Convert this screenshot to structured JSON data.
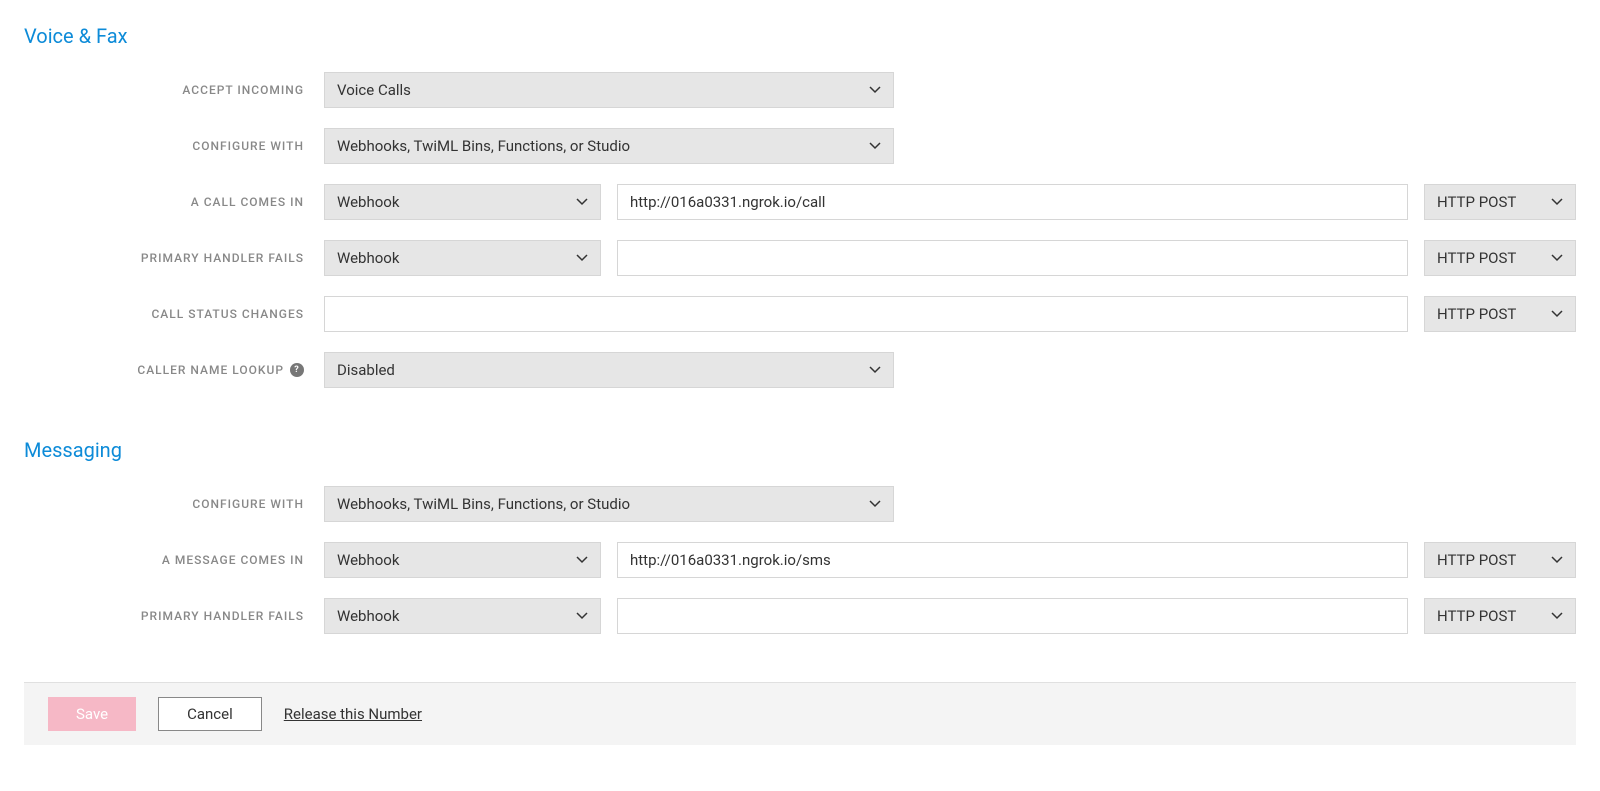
{
  "voiceFax": {
    "heading": "Voice & Fax",
    "acceptIncoming": {
      "label": "ACCEPT INCOMING",
      "value": "Voice Calls"
    },
    "configureWith": {
      "label": "CONFIGURE WITH",
      "value": "Webhooks, TwiML Bins, Functions, or Studio"
    },
    "callComesIn": {
      "label": "A CALL COMES IN",
      "handler": "Webhook",
      "url": "http://016a0331.ngrok.io/call",
      "method": "HTTP POST"
    },
    "primaryHandlerFails": {
      "label": "PRIMARY HANDLER FAILS",
      "handler": "Webhook",
      "url": "",
      "method": "HTTP POST"
    },
    "callStatusChanges": {
      "label": "CALL STATUS CHANGES",
      "url": "",
      "method": "HTTP POST"
    },
    "callerNameLookup": {
      "label": "CALLER NAME LOOKUP",
      "value": "Disabled"
    }
  },
  "messaging": {
    "heading": "Messaging",
    "configureWith": {
      "label": "CONFIGURE WITH",
      "value": "Webhooks, TwiML Bins, Functions, or Studio"
    },
    "messageComesIn": {
      "label": "A MESSAGE COMES IN",
      "handler": "Webhook",
      "url": "http://016a0331.ngrok.io/sms",
      "method": "HTTP POST"
    },
    "primaryHandlerFails": {
      "label": "PRIMARY HANDLER FAILS",
      "handler": "Webhook",
      "url": "",
      "method": "HTTP POST"
    }
  },
  "footer": {
    "save": "Save",
    "cancel": "Cancel",
    "release": "Release this Number"
  }
}
